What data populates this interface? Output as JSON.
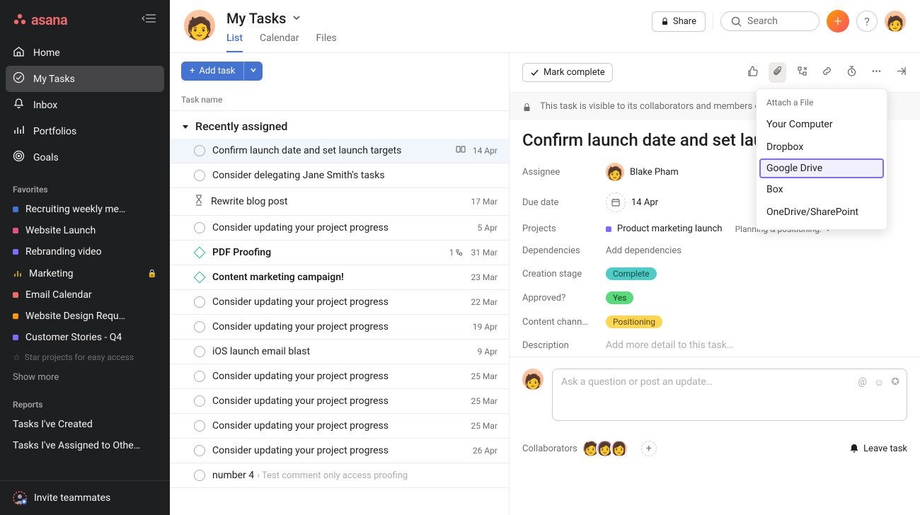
{
  "brand": "asana",
  "sidebar": {
    "nav": [
      {
        "icon": "home",
        "label": "Home"
      },
      {
        "icon": "check",
        "label": "My Tasks",
        "active": true
      },
      {
        "icon": "bell",
        "label": "Inbox"
      },
      {
        "icon": "bars",
        "label": "Portfolios"
      },
      {
        "icon": "goal",
        "label": "Goals"
      }
    ],
    "favorites_label": "Favorites",
    "favorites": [
      {
        "color": "#4573d2",
        "label": "Recruiting weekly me…"
      },
      {
        "color": "#e84f8a",
        "label": "Website Launch"
      },
      {
        "color": "#796eff",
        "label": "Rebranding video"
      },
      {
        "color": "#f1bd30",
        "label": "Marketing",
        "locked": true,
        "icon": "bars"
      },
      {
        "color": "#f06a6a",
        "label": "Email Calendar"
      },
      {
        "color": "#fd9a00",
        "label": "Website Design Requ…"
      },
      {
        "color": "#796eff",
        "label": "Customer Stories - Q4"
      }
    ],
    "star_hint": "Star projects for easy access",
    "show_more": "Show more",
    "reports_label": "Reports",
    "reports": [
      "Tasks I've Created",
      "Tasks I've Assigned to Othe…"
    ],
    "invite": "Invite teammates"
  },
  "header": {
    "title": "My Tasks",
    "tabs": [
      "List",
      "Calendar",
      "Files"
    ],
    "active_tab": "List",
    "share": "Share",
    "search_placeholder": "Search"
  },
  "list": {
    "add_task": "Add task",
    "col_header": "Task name",
    "group": "Recently assigned",
    "tasks": [
      {
        "icon": "check",
        "name": "Confirm launch date and set launch targets",
        "date": "14 Apr",
        "selected": true,
        "date_icon": true
      },
      {
        "icon": "check",
        "name": "Consider delegating Jane Smith's tasks"
      },
      {
        "icon": "hourglass",
        "name": "Rewrite blog post",
        "date": "17 Mar"
      },
      {
        "icon": "check",
        "name": "Consider updating your project progress",
        "date": "5 Apr"
      },
      {
        "icon": "milestone",
        "name": "PDF Proofing",
        "date": "31 Mar",
        "bold": true,
        "subtasks": "1"
      },
      {
        "icon": "milestone",
        "name": "Content  marketing campaign!",
        "date": "23 Mar",
        "bold": true
      },
      {
        "icon": "check",
        "name": "Consider updating your project progress",
        "date": "22 Mar"
      },
      {
        "icon": "check",
        "name": "Consider updating your project progress",
        "date": "19 Apr"
      },
      {
        "icon": "check",
        "name": "iOS launch email blast",
        "date": "9 Apr"
      },
      {
        "icon": "check",
        "name": "Consider updating your project progress",
        "date": "25 Mar"
      },
      {
        "icon": "check",
        "name": "Consider updating your project progress",
        "date": "25 Mar"
      },
      {
        "icon": "check",
        "name": "Consider updating your project progress",
        "date": "25 Mar"
      },
      {
        "icon": "check",
        "name": "Consider updating your project progress",
        "date": "26 Apr"
      },
      {
        "icon": "check",
        "name": "number 4",
        "date": "",
        "hint": "Test comment only access proofing"
      }
    ]
  },
  "detail": {
    "mark_complete": "Mark complete",
    "visibility": "This task is visible to its collaborators and members of Sales.",
    "title": "Confirm launch date and set launch targets",
    "fields": {
      "assignee_label": "Assignee",
      "assignee": "Blake Pham",
      "due_label": "Due date",
      "due": "14 Apr",
      "projects_label": "Projects",
      "project": "Product marketing launch",
      "project_section": "Planning & positioning:",
      "deps_label": "Dependencies",
      "deps": "Add dependencies",
      "stage_label": "Creation stage",
      "stage": "Complete",
      "approved_label": "Approved?",
      "approved": "Yes",
      "channel_label": "Content chann…",
      "channel": "Positioning",
      "desc_label": "Description",
      "desc_placeholder": "Add more detail to this task…"
    },
    "comment_placeholder": "Ask a question or post an update…",
    "collaborators_label": "Collaborators",
    "leave_task": "Leave task"
  },
  "dropdown": {
    "header": "Attach a File",
    "items": [
      "Your Computer",
      "Dropbox",
      "Google Drive",
      "Box",
      "OneDrive/SharePoint"
    ],
    "highlighted": "Google Drive"
  }
}
